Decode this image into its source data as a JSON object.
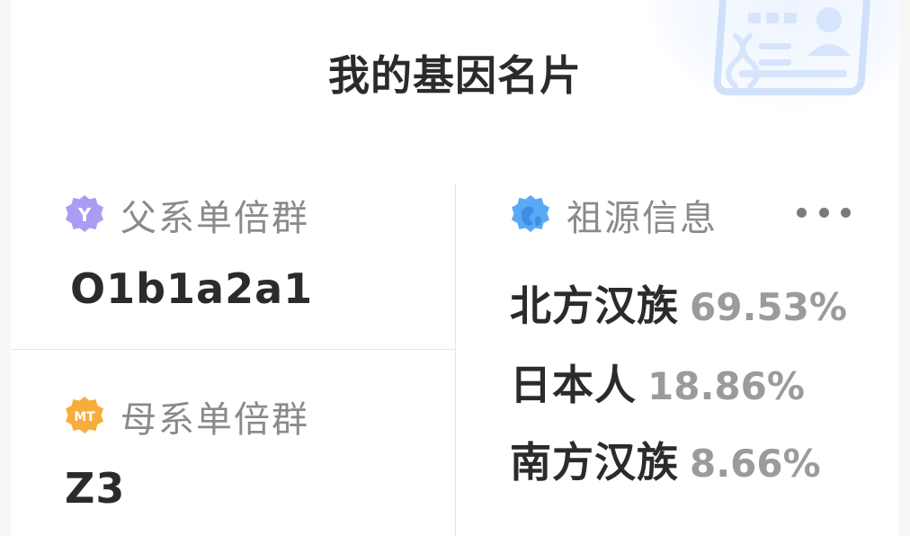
{
  "card": {
    "title": "我的基因名片"
  },
  "paternal": {
    "badge_text": "Y",
    "label": "父系单倍群",
    "value": "O1b1a2a1",
    "badge_color": "#a99cf5"
  },
  "maternal": {
    "badge_text": "MT",
    "label": "母系单倍群",
    "value": "Z3",
    "badge_color": "#f7ad3b"
  },
  "ancestry": {
    "label": "祖源信息",
    "icon_color": "#5aa9f5",
    "more_icon": "more-dots-icon",
    "items": [
      {
        "name": "北方汉族",
        "percent": "69.53%"
      },
      {
        "name": "日本人",
        "percent": "18.86%"
      },
      {
        "name": "南方汉族",
        "percent": "8.66%"
      }
    ]
  },
  "decoration": {
    "icon": "id-card-dna-icon"
  }
}
